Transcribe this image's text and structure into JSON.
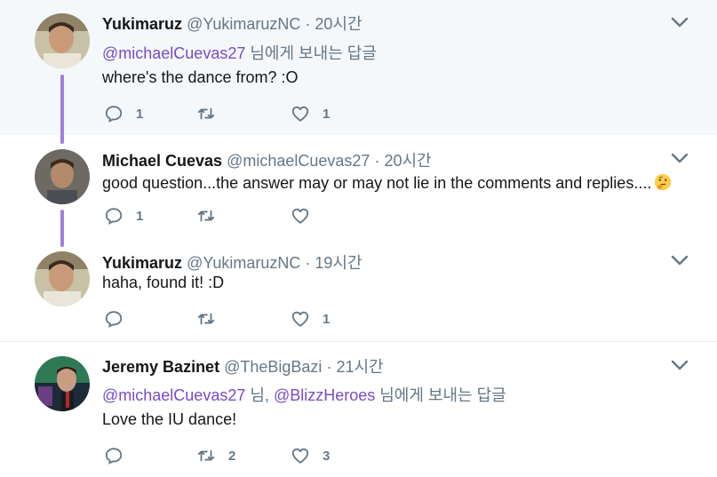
{
  "tweets": [
    {
      "name": "Yukimaruz",
      "handle": "@YukimaruzNC",
      "separator": "·",
      "time": "20시간",
      "reply_to": {
        "mention1": "@michaelCuevas27",
        "suffix": " 님에게 보내는 답글"
      },
      "text": "where's the dance from? :O",
      "replies": "1",
      "retweets": "",
      "likes": "1"
    },
    {
      "name": "Michael Cuevas",
      "handle": "@michaelCuevas27",
      "separator": "·",
      "time": "20시간",
      "text": "good question...the answer may or may not lie in the comments and replies....",
      "emoji": "thinking-face-icon",
      "replies": "1",
      "retweets": "",
      "likes": ""
    },
    {
      "name": "Yukimaruz",
      "handle": "@YukimaruzNC",
      "separator": "·",
      "time": "19시간",
      "text": "haha, found it! :D",
      "replies": "",
      "retweets": "",
      "likes": "1"
    },
    {
      "name": "Jeremy Bazinet",
      "handle": "@TheBigBazi",
      "separator": "·",
      "time": "21시간",
      "reply_to": {
        "mention1": "@michaelCuevas27",
        "middle": " 님, ",
        "mention2": "@BlizzHeroes",
        "suffix": " 님에게 보내는 답글"
      },
      "text": "Love the IU dance!",
      "replies": "",
      "retweets": "2",
      "likes": "3"
    }
  ],
  "colors": {
    "thread_line": "#a17fdc",
    "link": "#794bc4",
    "secondary_text": "#657786",
    "highlight_bg": "#f5f8fa"
  }
}
